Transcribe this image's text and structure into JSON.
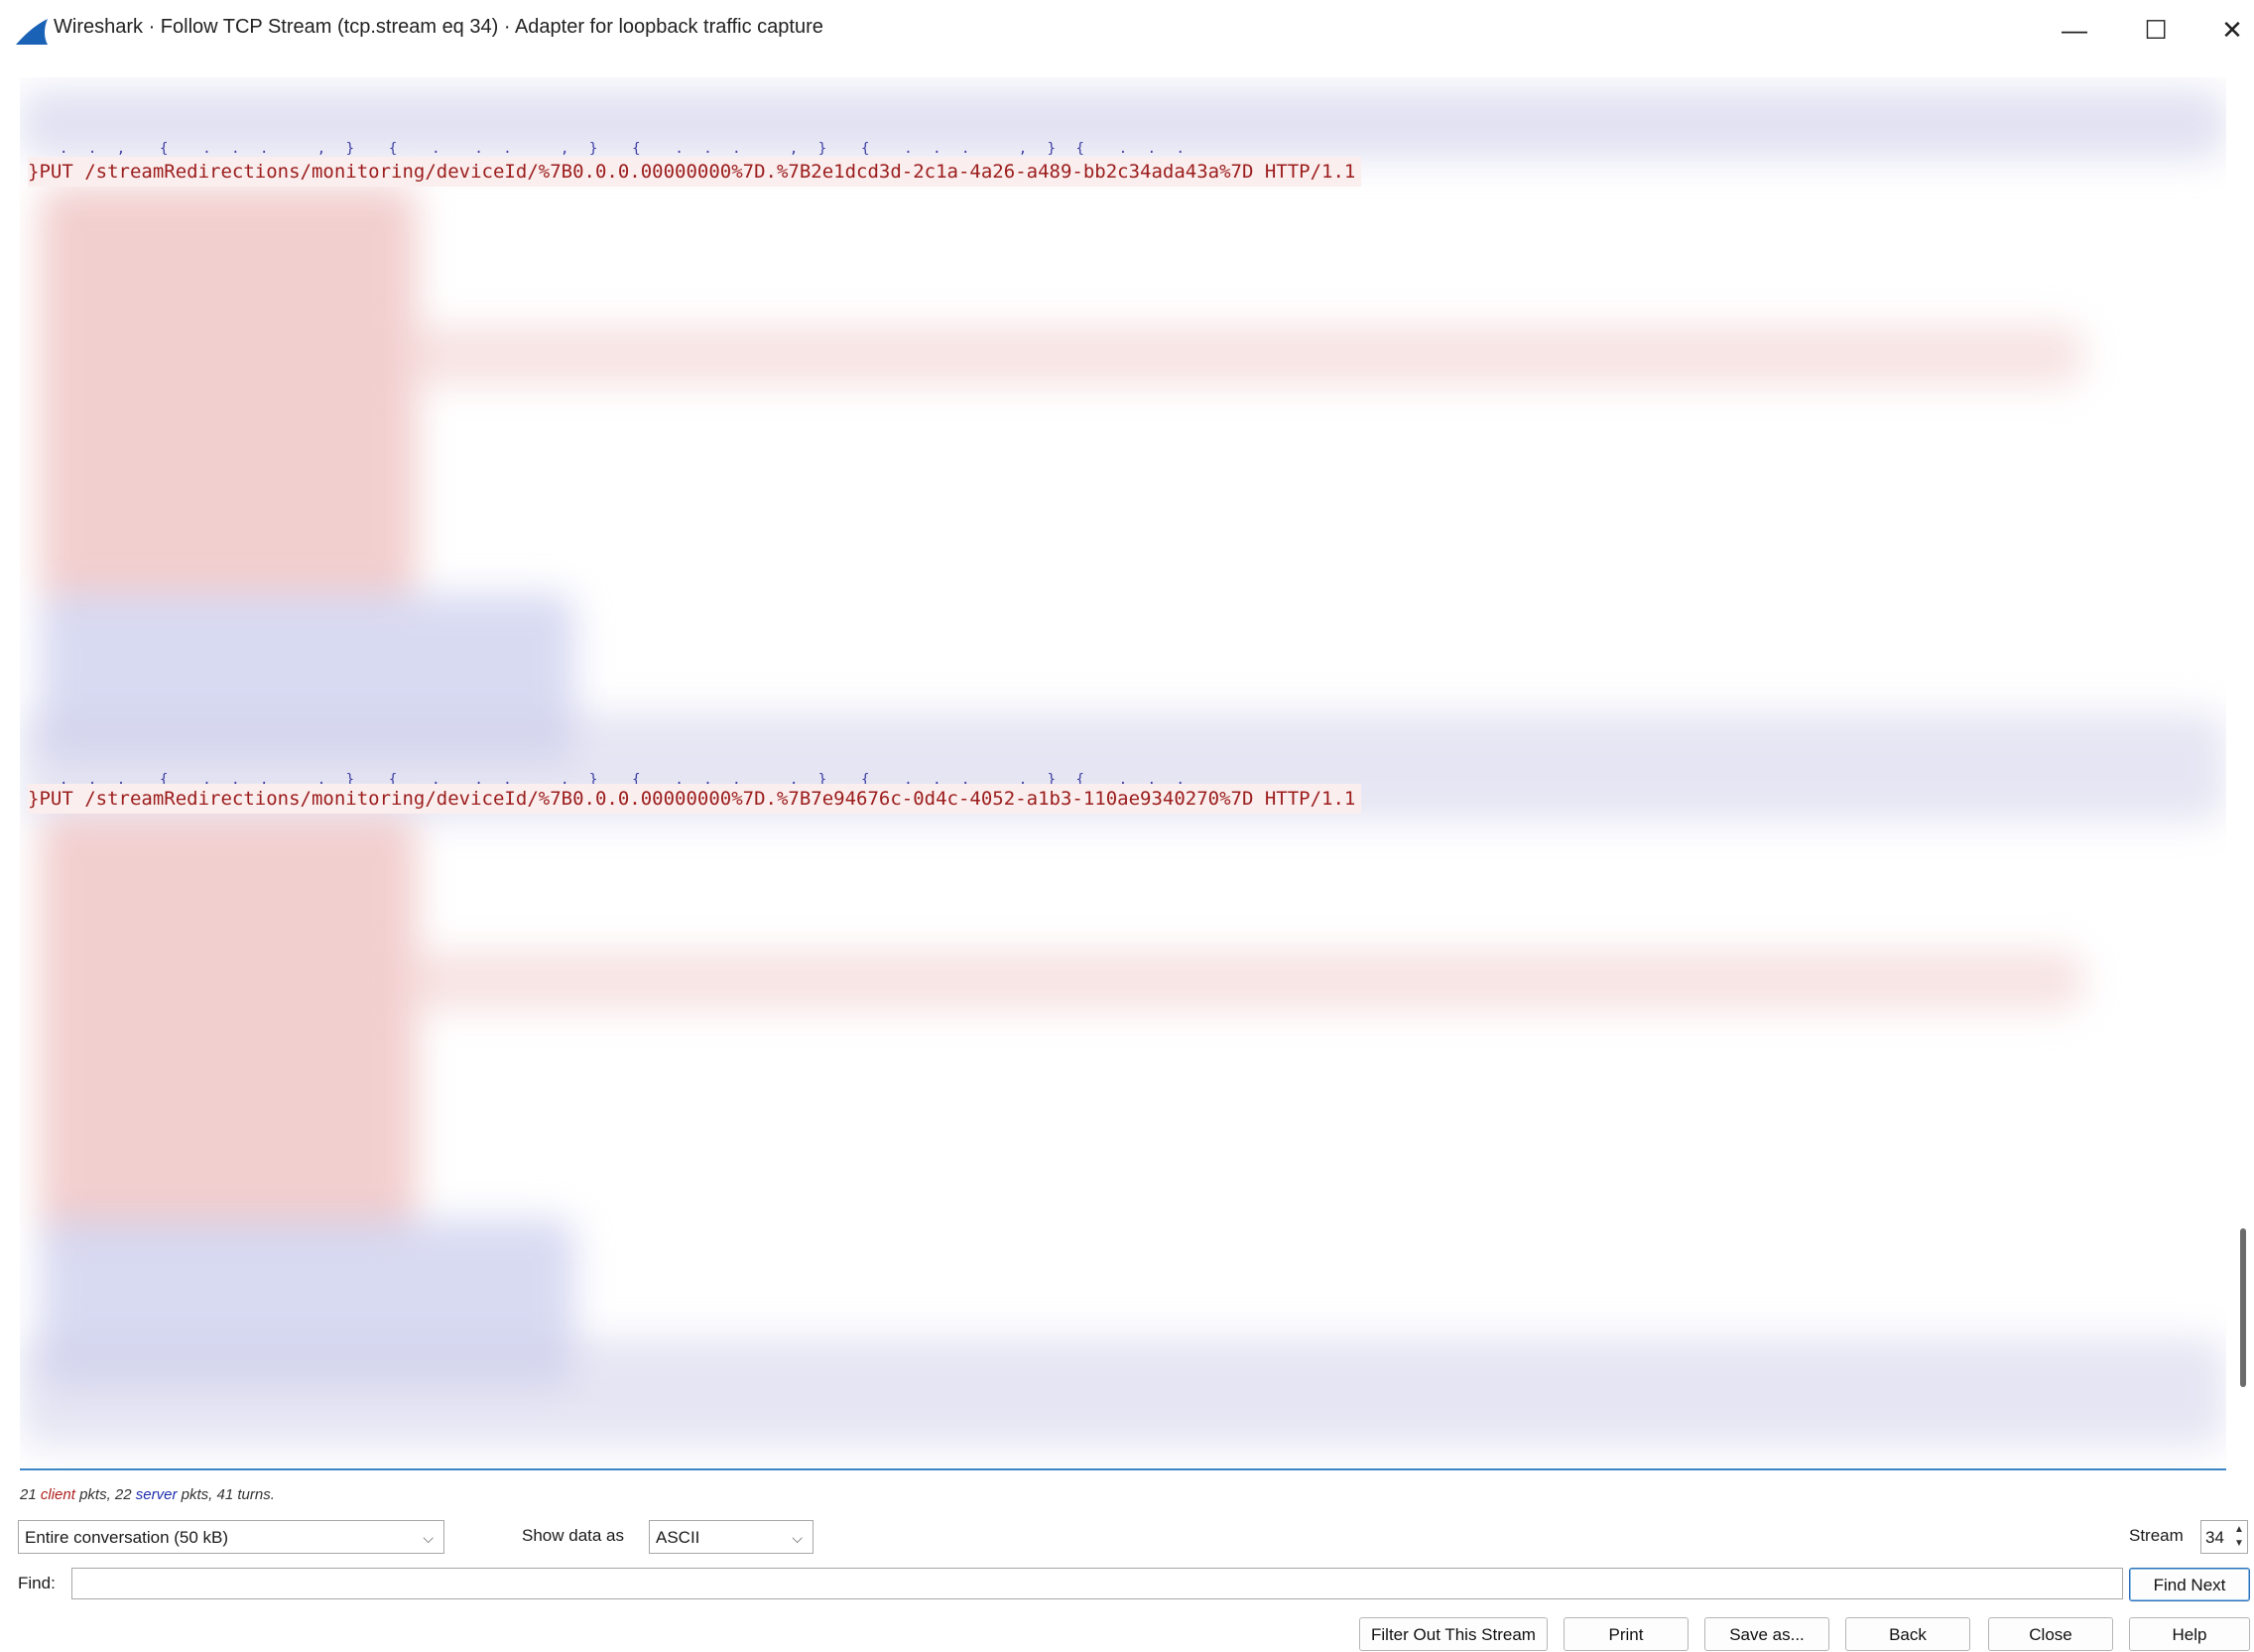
{
  "window": {
    "title": "Wireshark · Follow TCP Stream (tcp.stream eq 34) · Adapter for loopback traffic capture",
    "minimize_glyph": "—",
    "maximize_glyph": "☐",
    "close_glyph": "✕"
  },
  "stream": {
    "lines": [
      "}PUT /streamRedirections/monitoring/deviceId/%7B0.0.0.00000000%7D.%7B2e1dcd3d-2c1a-4a26-a489-bb2c34ada43a%7D HTTP/1.1",
      "}PUT /streamRedirections/monitoring/deviceId/%7B0.0.0.00000000%7D.%7B7e94676c-0d4c-4052-a1b3-110ae9340270%7D HTTP/1.1"
    ],
    "fragment": ". . ,  {  . . .   , }  {  .  . .   , }  {  . . .   , }  {  . . .   , } {  . . ."
  },
  "stats": {
    "client_count": "21",
    "client_word": "client",
    "client_suffix": "pkts,",
    "server_count": "22",
    "server_word": "server",
    "server_suffix": "pkts,",
    "turns": "41 turns."
  },
  "controls": {
    "conversation_select": "Entire conversation (50 kB)",
    "show_data_label": "Show data as",
    "show_data_select": "ASCII",
    "stream_label": "Stream",
    "stream_value": "34",
    "find_label": "Find:",
    "find_value": "",
    "find_next": "Find Next"
  },
  "buttons": {
    "filter_out": "Filter Out This Stream",
    "print": "Print",
    "save_as": "Save as...",
    "back": "Back",
    "close": "Close",
    "help": "Help"
  },
  "colors": {
    "client_text": "#9b1c1c",
    "server_text": "#1e2fb0",
    "accent": "#3b86c6"
  }
}
